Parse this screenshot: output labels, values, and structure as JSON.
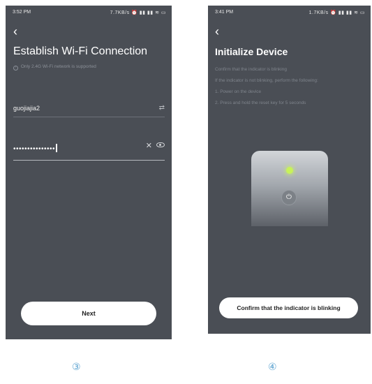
{
  "screen3": {
    "status": {
      "time": "3:52 PM",
      "icons": "7.7KB/s ⏰ ▮▮ ▮▮ ≋ ▭"
    },
    "back_icon": "‹",
    "title": "Establish Wi-Fi Connection",
    "note": "Only 2.4G Wi-Fi network is supported",
    "ssid": {
      "value": "guojiajia2",
      "switch_icon": "⇄"
    },
    "password": {
      "value": "•••••••••••••••",
      "clear_icon": "✕",
      "eye_icon": "eye-icon"
    },
    "next_label": "Next"
  },
  "screen4": {
    "status": {
      "time": "3:41 PM",
      "icons": "1.7KB/s ⏰ ▮▮ ▮▮ ≋ ▭"
    },
    "back_icon": "‹",
    "title": "Initialize Device",
    "lines": [
      "Confirm that the indicator is blinking",
      "If the indicator is not blinking, perform the following:",
      "1. Power on the device",
      "2. Press and hold the reset key for 5 seconds"
    ],
    "power_icon": "⏻",
    "confirm_label": "Confirm that the indicator is blinking"
  },
  "steps": {
    "three": "③",
    "four": "④"
  },
  "colors": {
    "screen_bg": "#4a4e55",
    "led": "#c8f25a",
    "step_number": "#5aa2d0"
  }
}
